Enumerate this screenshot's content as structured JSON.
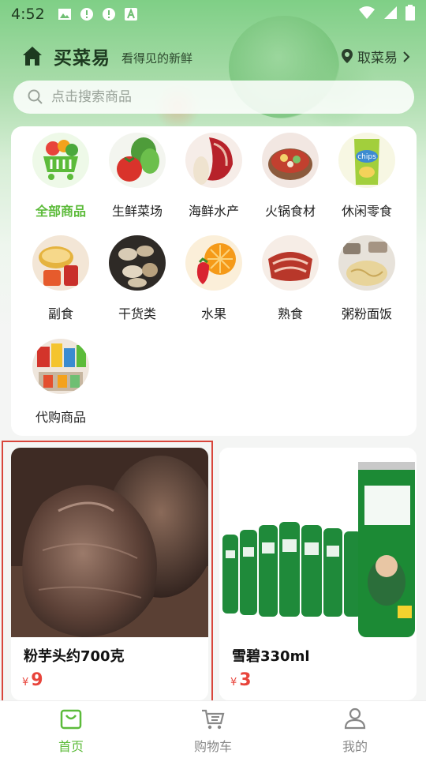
{
  "status_bar": {
    "time": "4:52"
  },
  "header": {
    "title": "买菜易",
    "slogan": "看得见的新鲜",
    "pickup_label": "取菜易"
  },
  "search": {
    "placeholder": "点击搜索商品"
  },
  "categories": [
    {
      "label": "全部商品",
      "icon": "shopping-cart-veg-icon",
      "active": true
    },
    {
      "label": "生鲜菜场",
      "icon": "fresh-vegetables-icon"
    },
    {
      "label": "海鲜水产",
      "icon": "seafood-icon"
    },
    {
      "label": "火锅食材",
      "icon": "hotpot-icon"
    },
    {
      "label": "休闲零食",
      "icon": "chips-icon"
    },
    {
      "label": "副食",
      "icon": "condiments-icon"
    },
    {
      "label": "干货类",
      "icon": "dried-goods-icon"
    },
    {
      "label": "水果",
      "icon": "fruit-icon"
    },
    {
      "label": "熟食",
      "icon": "cooked-meat-icon"
    },
    {
      "label": "粥粉面饭",
      "icon": "noodles-icon"
    },
    {
      "label": "代购商品",
      "icon": "purchase-agent-icon"
    }
  ],
  "products": [
    {
      "name": "粉芋头约700克",
      "currency": "¥",
      "price": "9"
    },
    {
      "name": "雪碧330ml",
      "currency": "¥",
      "price": "3"
    }
  ],
  "bottom_nav": [
    {
      "label": "首页",
      "icon": "home-bag-icon",
      "active": true
    },
    {
      "label": "购物车",
      "icon": "cart-icon"
    },
    {
      "label": "我的",
      "icon": "profile-icon"
    }
  ],
  "colors": {
    "accent": "#5cbb3a",
    "price": "#e8443b",
    "header_green": "#7fcf86"
  }
}
